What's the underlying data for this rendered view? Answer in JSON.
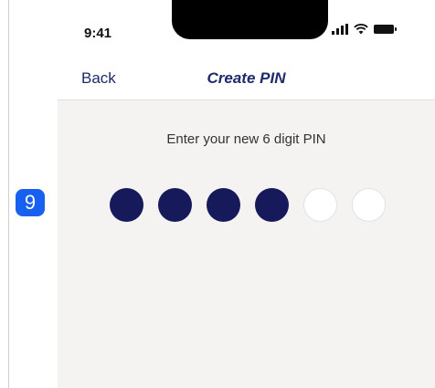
{
  "status_bar": {
    "time": "9:41",
    "icons": [
      "signal-icon",
      "wifi-icon",
      "battery-icon"
    ]
  },
  "nav": {
    "back_label": "Back",
    "title": "Create PIN"
  },
  "pin": {
    "prompt": "Enter your new 6 digit PIN",
    "length": 6,
    "filled": 4
  },
  "annotation": {
    "badge": "9"
  },
  "colors": {
    "accent": "#1f2a6b",
    "dot_filled": "#16195a",
    "badge": "#1860f0",
    "background": "#f4f3f2"
  }
}
